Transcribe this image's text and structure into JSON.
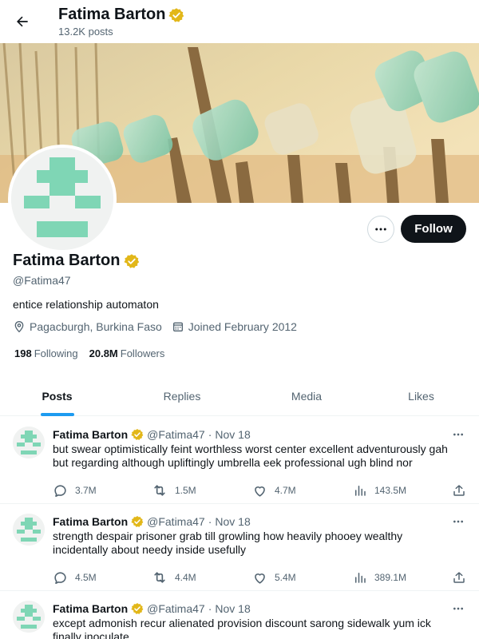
{
  "header": {
    "name": "Fatima Barton",
    "post_count": "13.2K posts"
  },
  "profile": {
    "name": "Fatima Barton",
    "handle": "@Fatima47",
    "bio": "entice relationship automaton",
    "location": "Pagacburgh, Burkina Faso",
    "joined": "Joined February 2012",
    "following_count": "198",
    "following_label": "Following",
    "followers_count": "20.8M",
    "followers_label": "Followers",
    "follow_button": "Follow"
  },
  "tabs": [
    {
      "label": "Posts",
      "active": true
    },
    {
      "label": "Replies",
      "active": false
    },
    {
      "label": "Media",
      "active": false
    },
    {
      "label": "Likes",
      "active": false
    }
  ],
  "posts": [
    {
      "name": "Fatima Barton",
      "handle": "@Fatima47",
      "separator": "·",
      "date": "Nov 18",
      "text": "but swear optimistically feint worthless worst center excellent adventurously gah but regarding although upliftingly umbrella eek professional ugh blind nor",
      "replies": "3.7M",
      "reposts": "1.5M",
      "likes": "4.7M",
      "views": "143.5M"
    },
    {
      "name": "Fatima Barton",
      "handle": "@Fatima47",
      "separator": "·",
      "date": "Nov 18",
      "text": "strength despair prisoner grab till growling how heavily phooey wealthy incidentally about needy inside usefully",
      "replies": "4.5M",
      "reposts": "4.4M",
      "likes": "5.4M",
      "views": "389.1M"
    },
    {
      "name": "Fatima Barton",
      "handle": "@Fatima47",
      "separator": "·",
      "date": "Nov 18",
      "text": "except admonish recur alienated provision discount sarong sidewalk yum ick finally inoculate",
      "replies": "",
      "reposts": "",
      "likes": "",
      "views": ""
    }
  ],
  "colors": {
    "accent": "#1d9bf0",
    "verified_badge": "#e2b719",
    "avatar_identicon": "#7fd6b5",
    "follow_button_bg": "#0f1419"
  },
  "icons": {
    "back": "arrow-left-icon",
    "verified": "verified-badge-icon",
    "location": "location-pin-icon",
    "calendar": "calendar-icon",
    "more": "more-dots-icon",
    "reply": "reply-icon",
    "repost": "repost-icon",
    "like": "heart-icon",
    "views": "views-bar-chart-icon",
    "share": "share-icon"
  }
}
